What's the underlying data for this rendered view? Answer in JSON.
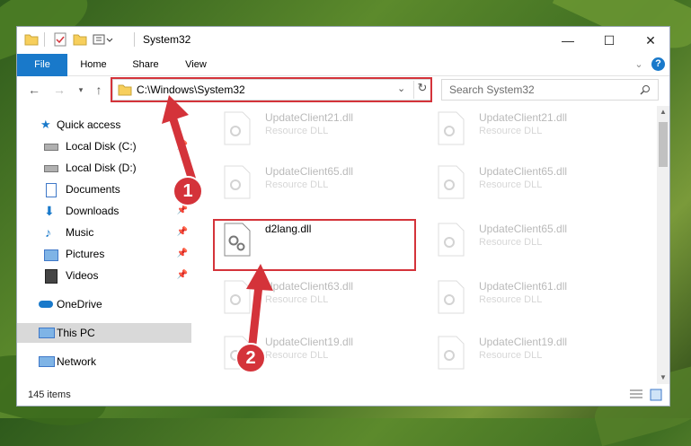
{
  "window": {
    "title": "System32",
    "controls": {
      "minimize": "—",
      "maximize": "☐",
      "close": "✕"
    }
  },
  "ribbon": {
    "tabs": [
      "File",
      "Home",
      "Share",
      "View"
    ]
  },
  "address": {
    "path": "C:\\Windows\\System32",
    "search_placeholder": "Search System32"
  },
  "navigation": {
    "items": [
      {
        "label": "Quick access",
        "icon": "star-icon",
        "pinned": false
      },
      {
        "label": "Local Disk (C:)",
        "icon": "drive-icon",
        "pinned": true
      },
      {
        "label": "Local Disk (D:)",
        "icon": "drive-icon",
        "pinned": false
      },
      {
        "label": "Documents",
        "icon": "documents-icon",
        "pinned": true
      },
      {
        "label": "Downloads",
        "icon": "download-icon",
        "pinned": true
      },
      {
        "label": "Music",
        "icon": "music-icon",
        "pinned": true
      },
      {
        "label": "Pictures",
        "icon": "pictures-icon",
        "pinned": true
      },
      {
        "label": "Videos",
        "icon": "videos-icon",
        "pinned": true
      },
      {
        "label": "OneDrive",
        "icon": "cloud-icon",
        "pinned": false
      },
      {
        "label": "This PC",
        "icon": "computer-icon",
        "pinned": false,
        "selected": true
      },
      {
        "label": "Network",
        "icon": "network-icon",
        "pinned": false
      }
    ]
  },
  "files": {
    "left": [
      {
        "name": "UpdateClient21.dll",
        "type": "Resource DLL",
        "faded": true
      },
      {
        "name": "UpdateClient65.dll",
        "type": "Resource DLL",
        "faded": true
      },
      {
        "name": "d2lang.dll",
        "type": "",
        "faded": false,
        "highlighted": true
      },
      {
        "name": "UpdateClient63.dll",
        "type": "Resource DLL",
        "faded": true
      },
      {
        "name": "UpdateClient19.dll",
        "type": "Resource DLL",
        "faded": true
      }
    ],
    "right": [
      {
        "name": "UpdateClient21.dll",
        "type": "Resource DLL",
        "faded": true
      },
      {
        "name": "UpdateClient65.dll",
        "type": "Resource DLL",
        "faded": true
      },
      {
        "name": "UpdateClient65.dll",
        "type": "Resource DLL",
        "faded": true
      },
      {
        "name": "UpdateClient61.dll",
        "type": "Resource DLL",
        "faded": true
      },
      {
        "name": "UpdateClient19.dll",
        "type": "Resource DLL",
        "faded": true
      }
    ]
  },
  "status": {
    "item_count": "145 items"
  },
  "annotations": {
    "step1": "1",
    "step2": "2",
    "color": "#d4333a"
  }
}
